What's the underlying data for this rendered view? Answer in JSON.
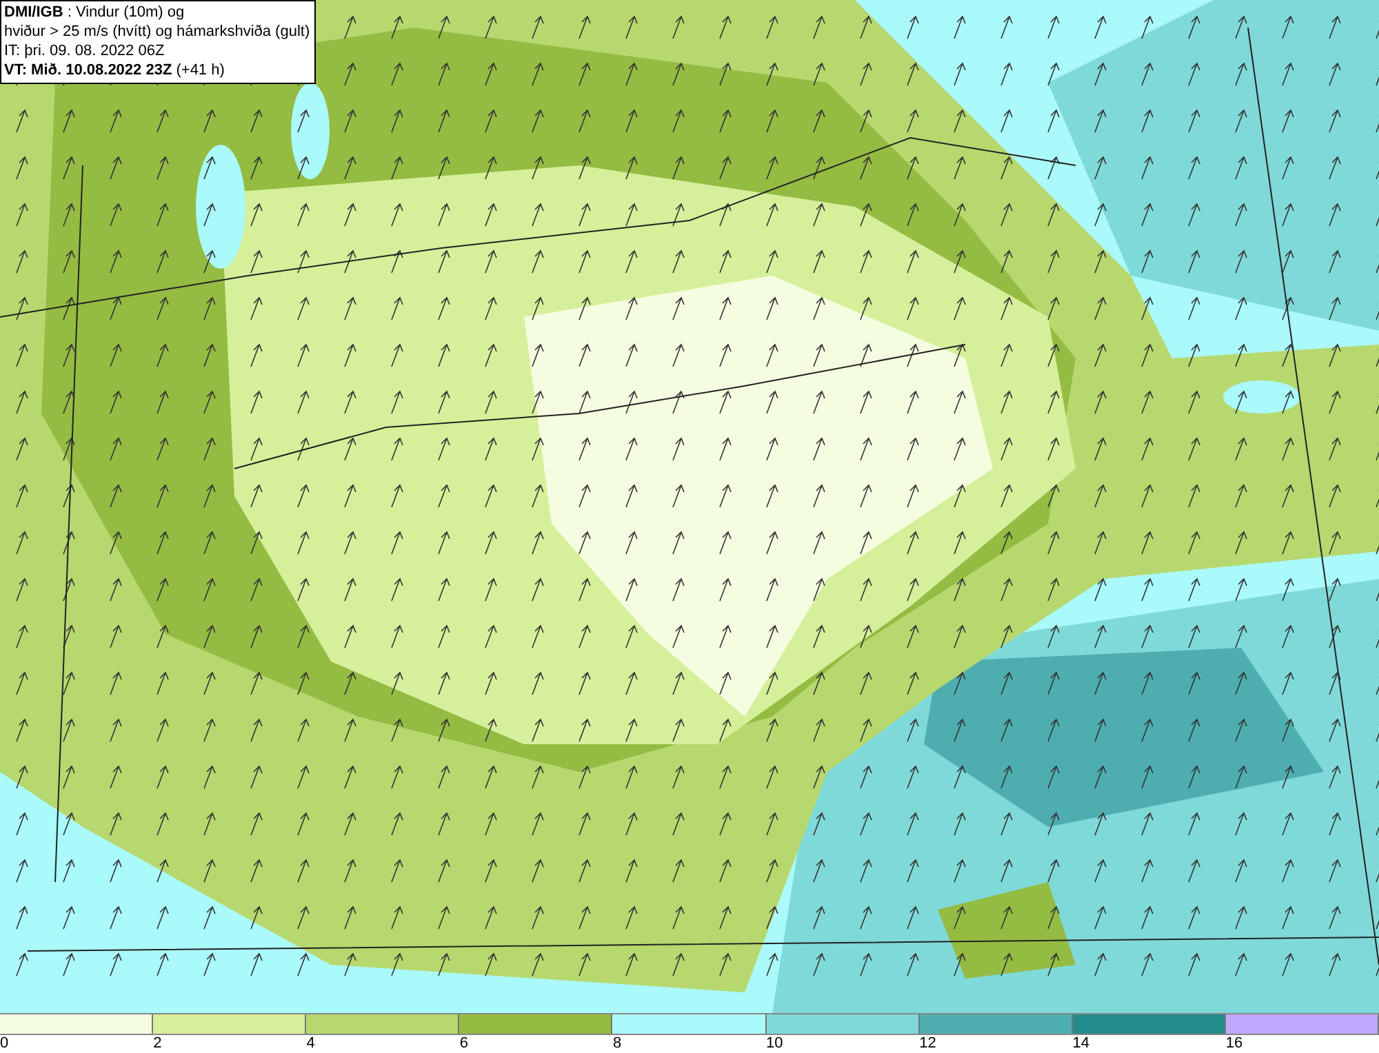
{
  "header": {
    "lines": [
      "**DMI/IGB** : Vindur (10m) og",
      "hviður > 25 m/s (hvítt) og hámarkshviða (gult)",
      "IT: þri. 09. 08. 2022 06Z",
      "**VT: Mið. 10.08.2022 23Z** (+41 h)"
    ]
  },
  "legend": {
    "bins": [
      {
        "label": "0",
        "color": "#f5fde0"
      },
      {
        "label": "2",
        "color": "#d6ef9a"
      },
      {
        "label": "4",
        "color": "#b6d86e"
      },
      {
        "label": "6",
        "color": "#94bb42"
      },
      {
        "label": "8",
        "color": "#aaf9fb"
      },
      {
        "label": "10",
        "color": "#7fd9d8"
      },
      {
        "label": "12",
        "color": "#4eaeaf"
      },
      {
        "label": "14",
        "color": "#228b8b"
      },
      {
        "label": "16",
        "color": "#c0a8ff"
      }
    ]
  }
}
